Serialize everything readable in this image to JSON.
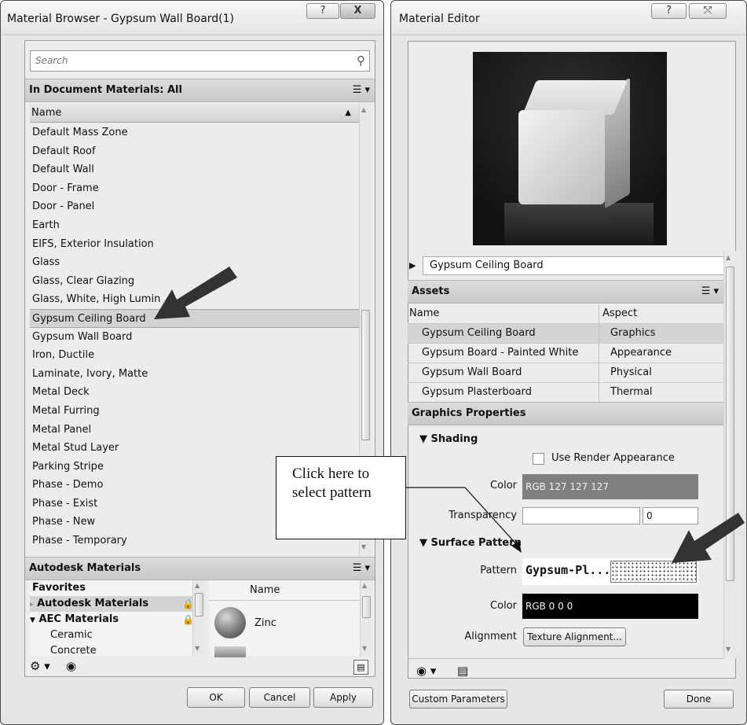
{
  "browser": {
    "title": "Material Browser - Gypsum Wall Board(1)",
    "help_btn": "?",
    "close_btn": "X",
    "search_placeholder": "Search",
    "in_doc_header": "In Document Materials: All",
    "col_name": "Name",
    "materials": [
      "Default Mass Zone",
      "Default Roof",
      "Default Wall",
      "Door - Frame",
      "Door - Panel",
      "Earth",
      "EIFS, Exterior Insulation",
      "Glass",
      "Glass, Clear Glazing",
      "Glass, White, High Lumin",
      "Gypsum Ceiling Board",
      "Gypsum Wall Board",
      "Iron, Ductile",
      "Laminate, Ivory, Matte",
      "Metal Deck",
      "Metal Furring",
      "Metal Panel",
      "Metal Stud Layer",
      "Parking Stripe",
      "Phase - Demo",
      "Phase - Exist",
      "Phase - New",
      "Phase - Temporary"
    ],
    "selected_material": "Gypsum Ceiling Board",
    "autodesk_header": "Autodesk Materials",
    "tree": {
      "favorites": "Favorites",
      "autodesk": "Autodesk Materials",
      "aec": "AEC Materials",
      "ceramic": "Ceramic",
      "concrete": "Concrete"
    },
    "grid_col_name": "Name",
    "grid_item": "Zinc",
    "ok": "OK",
    "cancel": "Cancel",
    "apply": "Apply"
  },
  "editor": {
    "title": "Material Editor",
    "help_btn": "?",
    "close_btn": "⤲",
    "asset_name": "Gypsum Ceiling Board",
    "assets_header": "Assets",
    "assets_col_name": "Name",
    "assets_col_aspect": "Aspect",
    "assets": [
      {
        "name": "Gypsum Ceiling Board",
        "aspect": "Graphics"
      },
      {
        "name": "Gypsum Board - Painted White",
        "aspect": "Appearance"
      },
      {
        "name": "Gypsum Wall Board",
        "aspect": "Physical"
      },
      {
        "name": "Gypsum Plasterboard",
        "aspect": "Thermal"
      }
    ],
    "graphics_header": "Graphics Properties",
    "shading_header": "Shading",
    "use_render": "Use Render Appearance",
    "color_label": "Color",
    "shading_color": "RGB 127 127 127",
    "transparency_label": "Transparency",
    "transparency_value": "0",
    "surface_header": "Surface Pattern",
    "pattern_label": "Pattern",
    "pattern_value": "Gypsum-Pl...",
    "surface_color_label": "Color",
    "surface_color": "RGB 0 0 0",
    "alignment_label": "Alignment",
    "alignment_btn": "Texture Alignment...",
    "custom_params": "Custom Parameters",
    "done": "Done"
  },
  "annotation": {
    "line1": "Click here to",
    "line2": "select pattern"
  },
  "colors": {
    "shading_swatch": "#7f7f7f",
    "surface_swatch": "#000000"
  }
}
